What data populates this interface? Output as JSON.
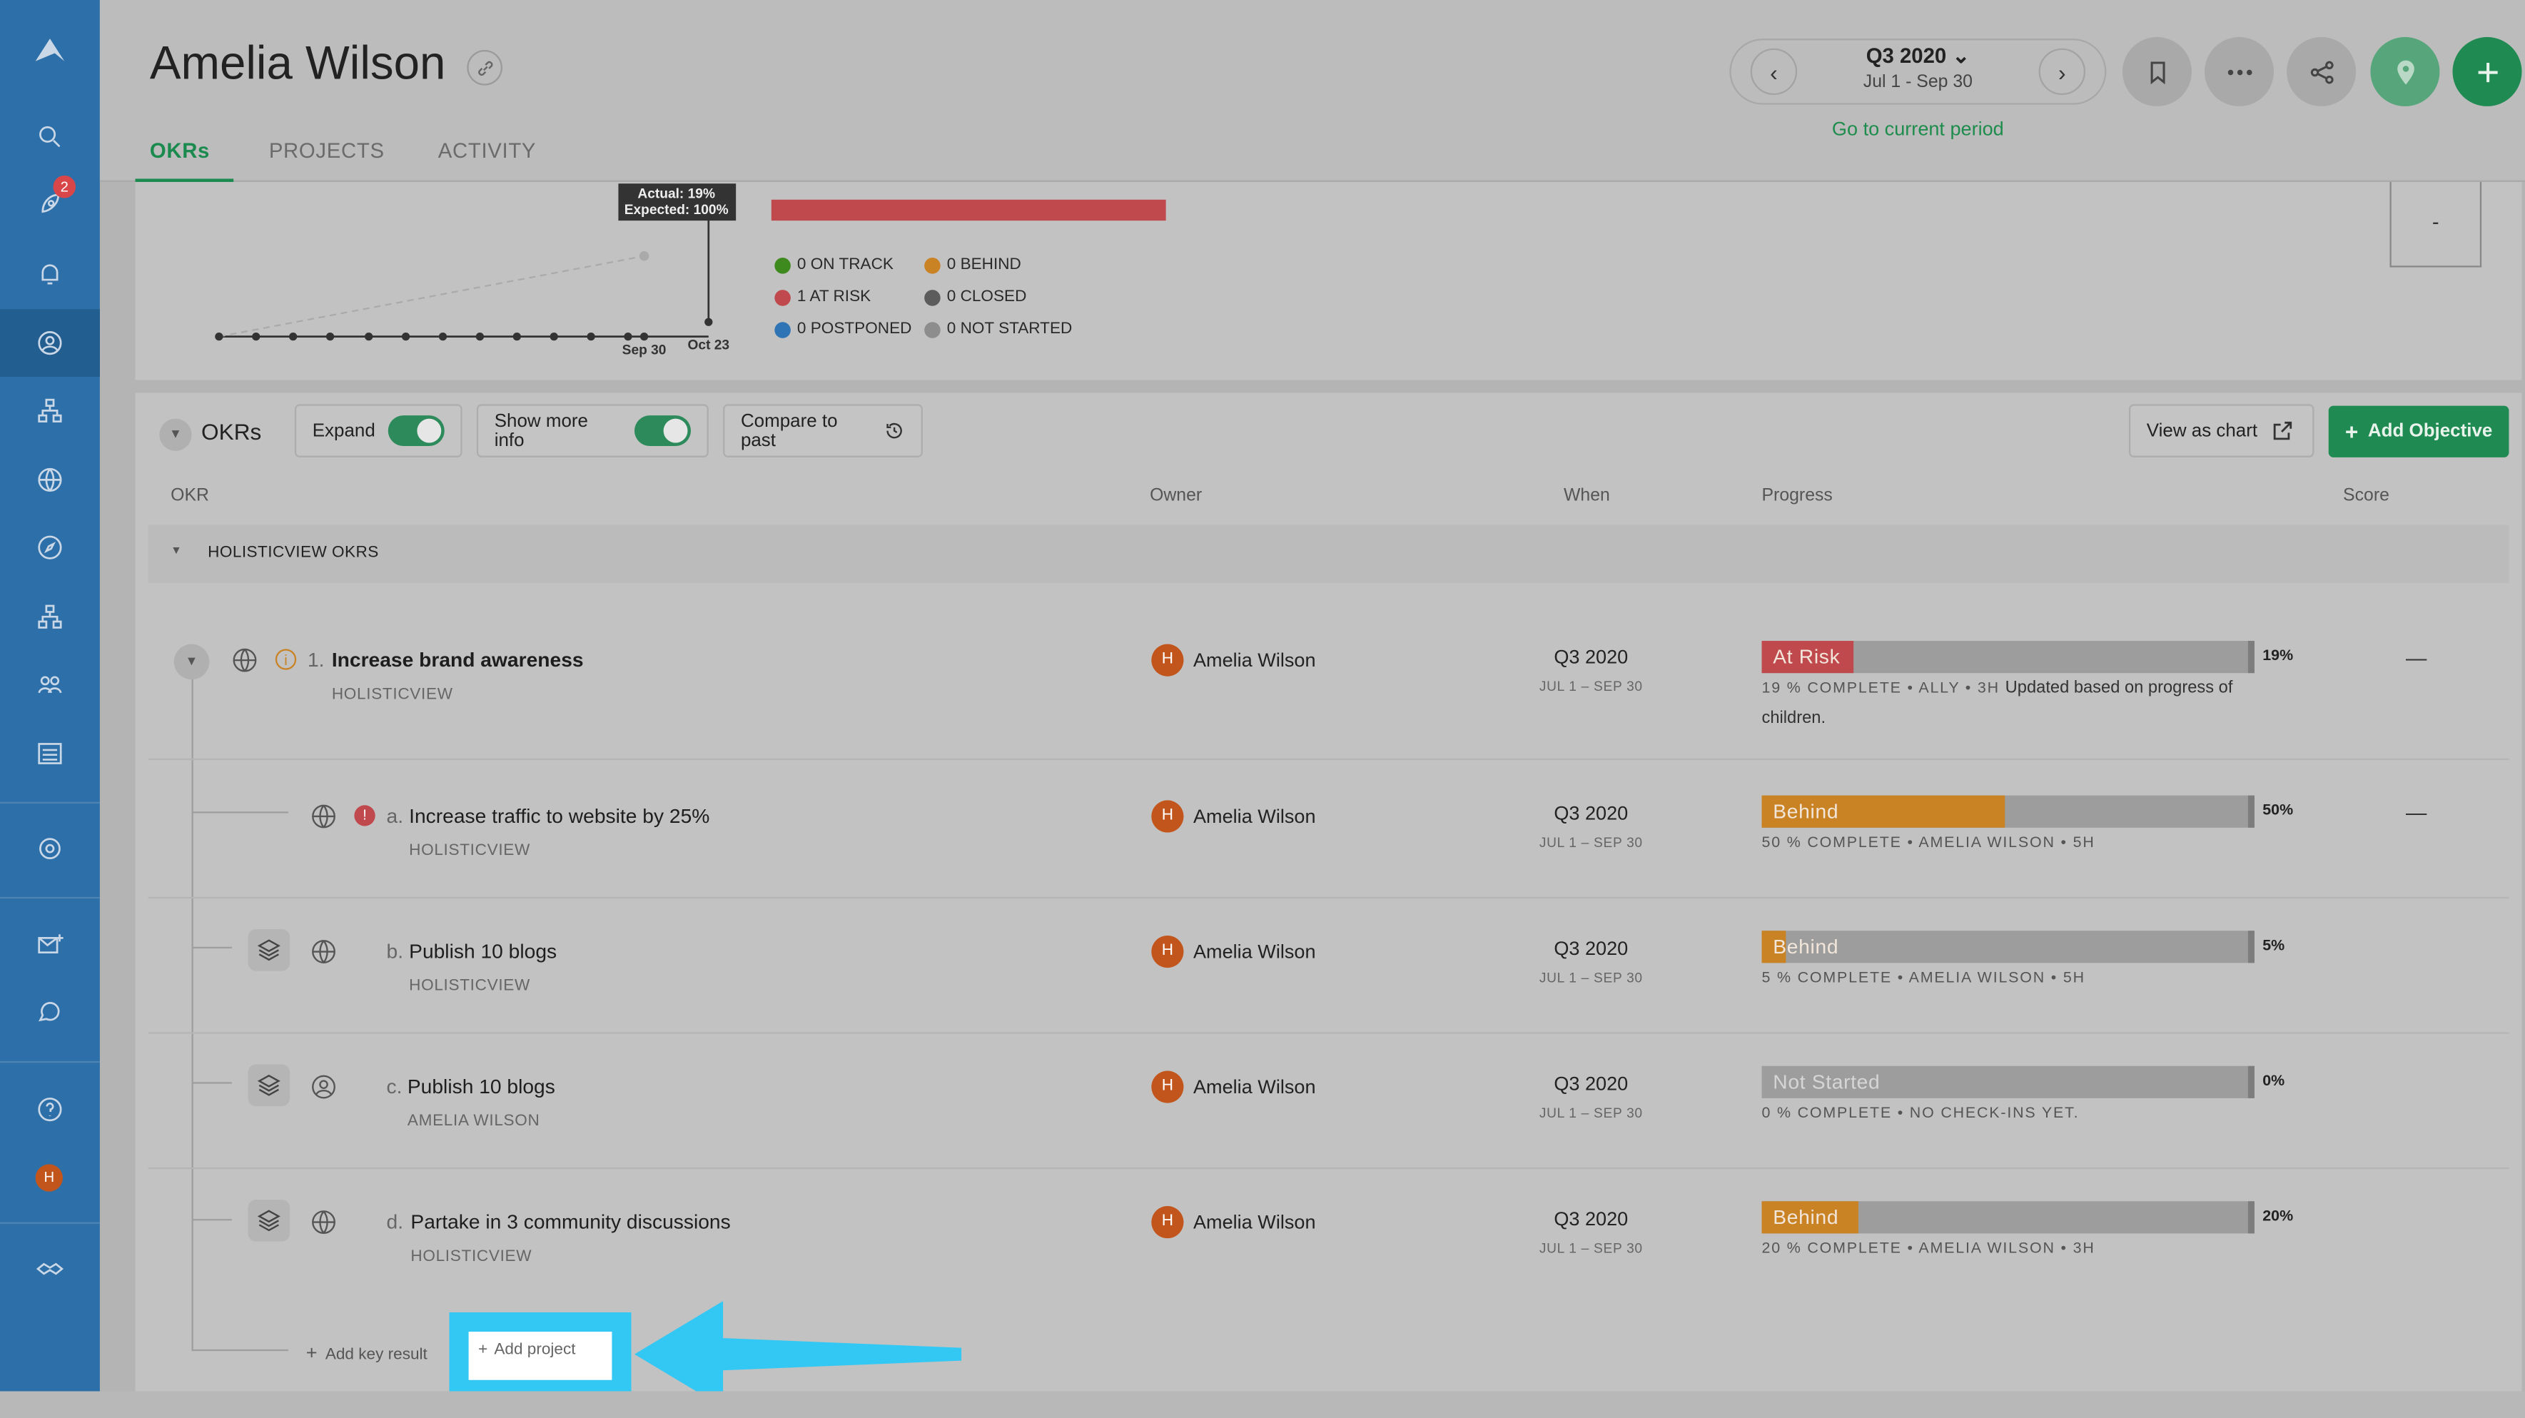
{
  "sidebar": {
    "notifications_badge": "2",
    "avatar_initial": "H"
  },
  "header": {
    "title": "Amelia Wilson",
    "tabs": [
      {
        "label": "OKRs"
      },
      {
        "label": "PROJECTS"
      },
      {
        "label": "ACTIVITY"
      }
    ],
    "period": {
      "label": "Q3 2020",
      "range": "Jul 1 - Sep 30",
      "go_current": "Go to current period"
    }
  },
  "chart": {
    "tooltip_actual": "Actual: 19%",
    "tooltip_expected": "Expected: 100%",
    "x_ticks": [
      "Sep 30",
      "Oct 23"
    ],
    "legend": [
      {
        "label": "0 ON TRACK",
        "color": "#3f8a1f"
      },
      {
        "label": "0 BEHIND",
        "color": "#c98224"
      },
      {
        "label": "1 AT RISK",
        "color": "#c0494e"
      },
      {
        "label": "0 CLOSED",
        "color": "#5c5c5c"
      },
      {
        "label": "0 POSTPONED",
        "color": "#2f74b4"
      },
      {
        "label": "0 NOT STARTED",
        "color": "#8d8d8d"
      }
    ],
    "side_value": "-"
  },
  "okr_panel": {
    "title": "OKRs",
    "expand_label": "Expand",
    "more_info_label": "Show more info",
    "compare_label": "Compare to past",
    "view_chart_label": "View as chart",
    "add_objective_label": "Add Objective",
    "columns": [
      "OKR",
      "Owner",
      "When",
      "Progress",
      "Score"
    ],
    "group_label": "HOLISTICVIEW OKRS",
    "rows": [
      {
        "index": "1.",
        "title": "Increase brand awareness",
        "sub": "HOLISTICVIEW",
        "owner": "Amelia Wilson",
        "owner_initial": "H",
        "quarter": "Q3 2020",
        "range": "JUL 1 – SEP 30",
        "status": "At Risk",
        "status_color": "#c0494e",
        "progress": 19,
        "pct": "19%",
        "meta": "19 % COMPLETE • ALLY • 3H",
        "note": "Updated based on progress of",
        "note2": "children.",
        "score": "—"
      },
      {
        "index": "a.",
        "title": "Increase traffic to website by 25%",
        "sub": "HOLISTICVIEW",
        "owner": "Amelia Wilson",
        "owner_initial": "H",
        "quarter": "Q3 2020",
        "range": "JUL 1 – SEP 30",
        "status": "Behind",
        "status_color": "#c98224",
        "progress": 50,
        "pct": "50%",
        "meta": "50 % COMPLETE • AMELIA WILSON • 5H",
        "score": "—"
      },
      {
        "index": "b.",
        "title": "Publish 10 blogs",
        "sub": "HOLISTICVIEW",
        "owner": "Amelia Wilson",
        "owner_initial": "H",
        "quarter": "Q3 2020",
        "range": "JUL 1 – SEP 30",
        "status": "Behind",
        "status_color": "#c98224",
        "progress": 5,
        "pct": "5%",
        "meta": "5 % COMPLETE • AMELIA WILSON • 5H",
        "score": ""
      },
      {
        "index": "c.",
        "title": "Publish 10 blogs",
        "sub": "AMELIA WILSON",
        "owner": "Amelia Wilson",
        "owner_initial": "H",
        "quarter": "Q3 2020",
        "range": "JUL 1 – SEP 30",
        "status": "Not Started",
        "status_color": "#9d9d9d",
        "progress": 0,
        "pct": "0%",
        "meta": "0 % COMPLETE • NO CHECK-INS YET.",
        "score": ""
      },
      {
        "index": "d.",
        "title": "Partake in 3 community discussions",
        "sub": "HOLISTICVIEW",
        "owner": "Amelia Wilson",
        "owner_initial": "H",
        "quarter": "Q3 2020",
        "range": "JUL 1 – SEP 30",
        "status": "Behind",
        "status_color": "#c98224",
        "progress": 20,
        "pct": "20%",
        "meta": "20 % COMPLETE • AMELIA WILSON • 3H",
        "score": ""
      }
    ],
    "add_key_result_label": "Add key result",
    "add_project_label": "Add project"
  }
}
